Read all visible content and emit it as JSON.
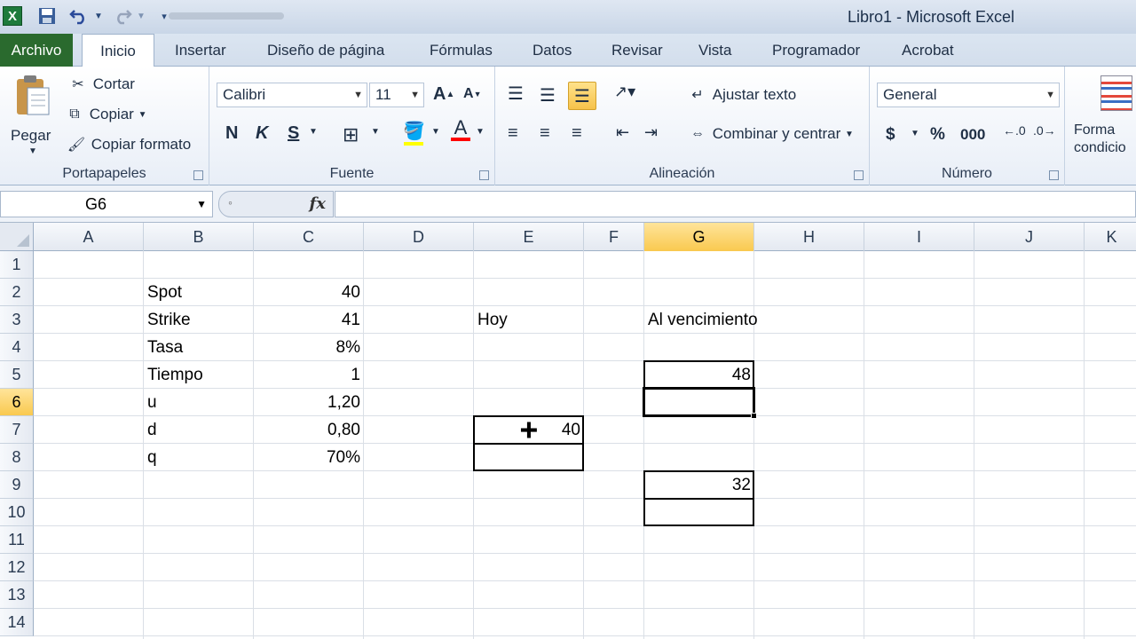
{
  "window": {
    "title": "Libro1  -  Microsoft Excel",
    "app_logo": "X"
  },
  "qat": {
    "save_icon": "save-icon",
    "undo_icon": "undo-icon",
    "redo_icon": "redo-icon",
    "customize_icon": "customize-icon"
  },
  "tabs": [
    "Archivo",
    "Inicio",
    "Insertar",
    "Diseño de página",
    "Fórmulas",
    "Datos",
    "Revisar",
    "Vista",
    "Programador",
    "Acrobat"
  ],
  "ribbon": {
    "clipboard": {
      "label": "Portapapeles",
      "paste": "Pegar",
      "cut": "Cortar",
      "copy": "Copiar",
      "format_painter": "Copiar formato"
    },
    "font": {
      "label": "Fuente",
      "font_name": "Calibri",
      "font_size": "11",
      "bold": "N",
      "italic": "K",
      "underline": "S"
    },
    "alignment": {
      "label": "Alineación",
      "wrap_text": "Ajustar texto",
      "merge_center": "Combinar y centrar"
    },
    "number": {
      "label": "Número",
      "format": "General",
      "currency": "$",
      "percent": "%",
      "thousands": "000"
    },
    "styles": {
      "conditional": "Forma condicio"
    }
  },
  "formula_bar": {
    "name_box": "G6",
    "fx": "fx",
    "content": ""
  },
  "grid": {
    "columns": [
      "A",
      "B",
      "C",
      "D",
      "E",
      "F",
      "G",
      "H",
      "I",
      "J",
      "K"
    ],
    "rows": [
      "1",
      "2",
      "3",
      "4",
      "5",
      "6",
      "7",
      "8",
      "9",
      "10",
      "11",
      "12",
      "13",
      "14"
    ],
    "selected_column": "G",
    "selected_row": "6",
    "cells": {
      "B2": "Spot",
      "C2": "40",
      "B3": "Strike",
      "C3": "41",
      "B4": "Tasa",
      "C4": "8%",
      "B5": "Tiempo",
      "C5": "1",
      "B6": "u",
      "C6": "1,20",
      "B7": "d",
      "C7": "0,80",
      "B8": "q",
      "C8": "70%",
      "E3": "Hoy",
      "G3": "Al vencimiento",
      "G5": "48",
      "E7": "40",
      "G9": "32"
    }
  }
}
